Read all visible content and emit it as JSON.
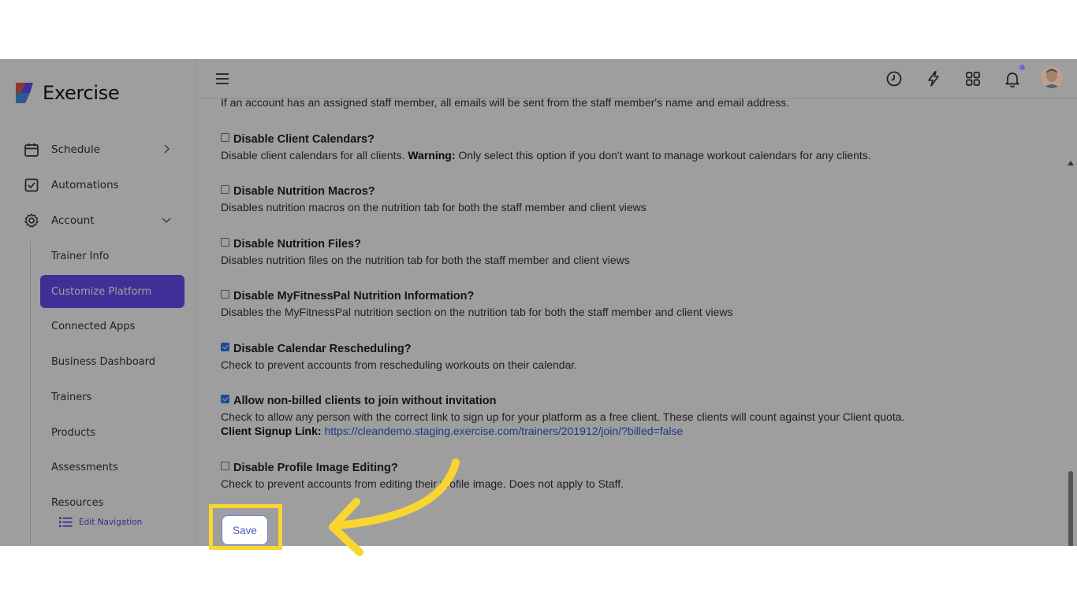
{
  "app": {
    "name": "Exercise"
  },
  "sidebar": {
    "items": [
      {
        "label": "Schedule",
        "icon": "calendar-icon"
      },
      {
        "label": "Automations",
        "icon": "checkbox-icon"
      },
      {
        "label": "Account",
        "icon": "gear-icon"
      }
    ],
    "account_sub": [
      {
        "label": "Trainer Info"
      },
      {
        "label": "Customize Platform",
        "active": true
      },
      {
        "label": "Connected Apps"
      },
      {
        "label": "Business Dashboard"
      },
      {
        "label": "Trainers"
      },
      {
        "label": "Products"
      },
      {
        "label": "Assessments"
      },
      {
        "label": "Resources"
      }
    ],
    "edit_navigation": "Edit Navigation"
  },
  "topbar": {
    "icons": [
      "menu-icon",
      "clock-icon",
      "lightning-icon",
      "apps-grid-icon",
      "bell-icon",
      "avatar"
    ]
  },
  "content": {
    "truncated_text": "If an account has an assigned staff member, all emails will be sent from the staff member's name and email address.",
    "settings": [
      {
        "title": "Disable Client Calendars?",
        "checked": false,
        "desc_pre": "Disable client calendars for all clients. ",
        "desc_bold": "Warning:",
        "desc_post": " Only select this option if you don't want to manage workout calendars for any clients."
      },
      {
        "title": "Disable Nutrition Macros?",
        "checked": false,
        "desc": "Disables nutrition macros on the nutrition tab for both the staff member and client views"
      },
      {
        "title": "Disable Nutrition Files?",
        "checked": false,
        "desc": "Disables nutrition files on the nutrition tab for both the staff member and client views"
      },
      {
        "title": "Disable MyFitnessPal Nutrition Information?",
        "checked": false,
        "desc": "Disables the MyFitnessPal nutrition section on the nutrition tab for both the staff member and client views"
      },
      {
        "title": "Disable Calendar Rescheduling?",
        "checked": true,
        "desc": "Check to prevent accounts from rescheduling workouts on their calendar."
      },
      {
        "title": "Allow non-billed clients to join without invitation",
        "checked": true,
        "desc": "Check to allow any person with the correct link to sign up for your platform as a free client. These clients will count against your Client quota.",
        "link_label": "Client Signup Link:",
        "link_url": "https://cleandemo.staging.exercise.com/trainers/201912/join/?billed=false"
      },
      {
        "title": "Disable Profile Image Editing?",
        "checked": false,
        "desc": "Check to prevent accounts from editing their profile image. Does not apply to Staff."
      }
    ],
    "save_label": "Save"
  },
  "annotation": {
    "highlight_color": "#f9d62f",
    "arrow_color": "#f9d62f",
    "overlay": "dimmed"
  }
}
